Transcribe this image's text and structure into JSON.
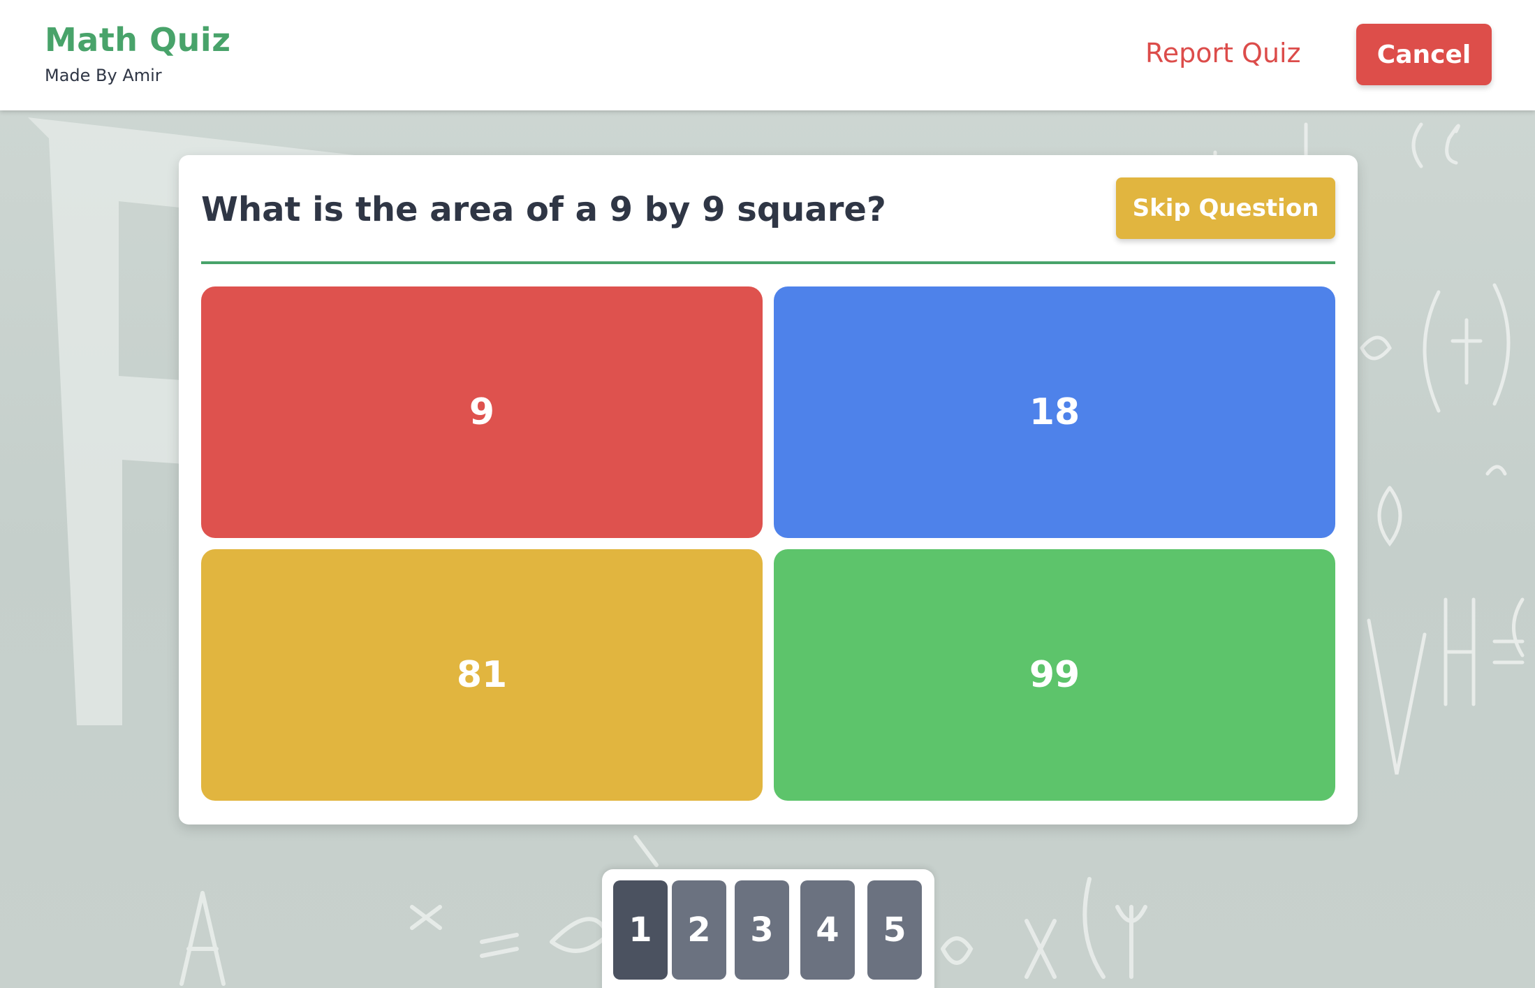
{
  "header": {
    "title": "Math Quiz",
    "subtitle": "Made By Amir",
    "report_label": "Report Quiz",
    "cancel_label": "Cancel"
  },
  "quiz": {
    "question": "What is the area of a 9 by 9 square?",
    "skip_label": "Skip Question",
    "answers": [
      {
        "label": "9",
        "color": "#de524e"
      },
      {
        "label": "18",
        "color": "#4e82ea"
      },
      {
        "label": "81",
        "color": "#e1b53f"
      },
      {
        "label": "99",
        "color": "#5dc46b"
      }
    ]
  },
  "pagination": {
    "pages": [
      "1",
      "2",
      "3",
      "4",
      "5"
    ],
    "active_page": "1"
  },
  "colors": {
    "brand": "#48a36a",
    "danger": "#dd4e4a",
    "warning": "#e1b53f"
  }
}
